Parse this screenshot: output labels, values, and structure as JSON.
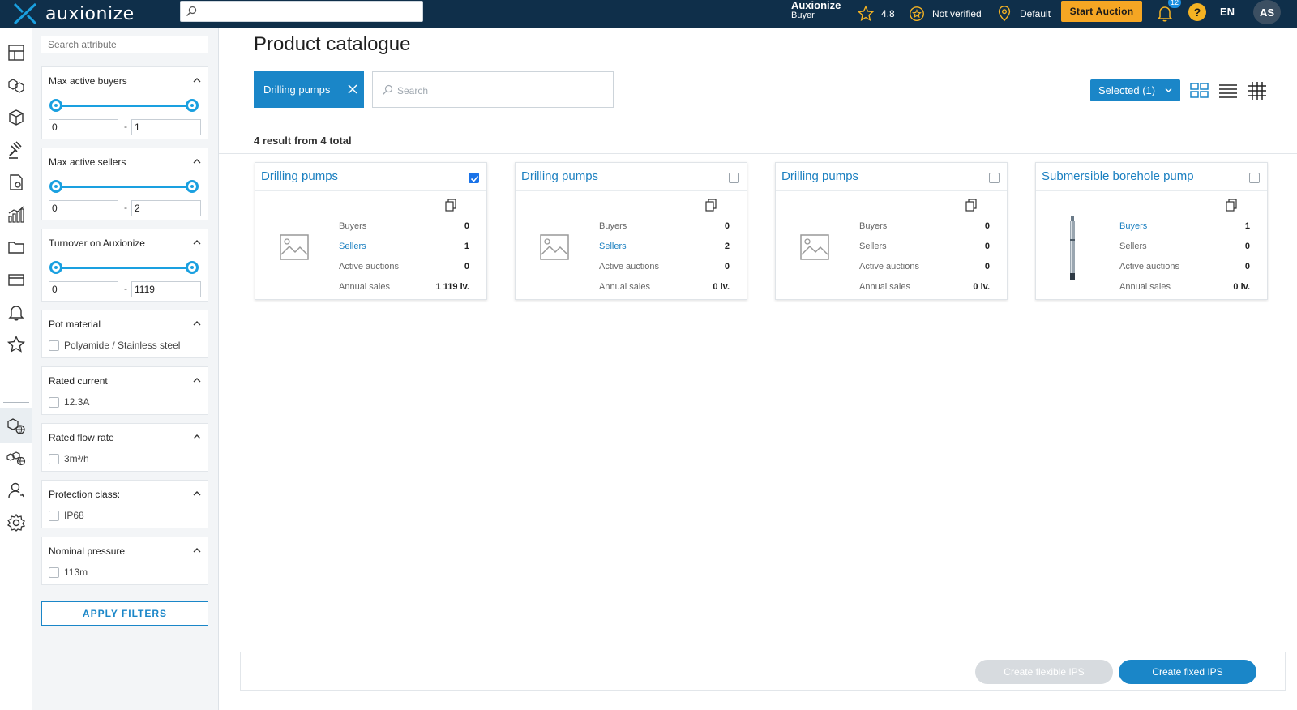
{
  "header": {
    "logo_text": "auxionize",
    "search_value": "",
    "user_name": "Auxionize",
    "user_role": "Buyer",
    "rating": "4.8",
    "verification": "Not verified",
    "location": "Default",
    "start_auction_label": "Start Auction",
    "notification_count": "12",
    "help_label": "?",
    "language": "EN",
    "avatar_initials": "AS",
    "colors": {
      "bar": "#0f2f4a",
      "accent": "#f5a623",
      "primary": "#1a86c8"
    }
  },
  "rail": {
    "icons": [
      "dashboard-icon",
      "products-icon",
      "box-icon",
      "auction-gavel-icon",
      "documents-icon",
      "analytics-icon",
      "folder-icon",
      "card-icon",
      "bell-icon",
      "star-icon",
      "product-catalogue-icon",
      "global-products-icon",
      "user-icon",
      "settings-icon"
    ],
    "expand_label": "»"
  },
  "filters": {
    "search_placeholder": "Search attribute",
    "ranges": [
      {
        "title": "Max active buyers",
        "min": "0",
        "max": "1",
        "separator": "-"
      },
      {
        "title": "Max active sellers",
        "min": "0",
        "max": "2",
        "separator": "-"
      },
      {
        "title": "Turnover on Auxionize",
        "min": "0",
        "max": "1119",
        "separator": "-"
      }
    ],
    "checks": [
      {
        "title": "Pot material",
        "option": "Polyamide / Stainless steel"
      },
      {
        "title": "Rated current",
        "option": "12.3A"
      },
      {
        "title": "Rated flow rate",
        "option": "3m³/h"
      },
      {
        "title": "Protection class:",
        "option": "IP68"
      },
      {
        "title": "Nominal pressure",
        "option": "113m"
      }
    ],
    "apply_label": "APPLY FILTERS"
  },
  "main": {
    "title": "Product catalogue",
    "chip_label": "Drilling pumps",
    "search_placeholder": "Search",
    "selected_label": "Selected (1)",
    "result_text": "4 result from 4 total",
    "stat_labels": [
      "Buyers",
      "Sellers",
      "Active auctions",
      "Annual sales"
    ],
    "cards": [
      {
        "title": "Drilling pumps",
        "checked": true,
        "buyers": "0",
        "sellers": "1",
        "active_auctions": "0",
        "annual_sales": "1 119 lv."
      },
      {
        "title": "Drilling pumps",
        "checked": false,
        "buyers": "0",
        "sellers": "2",
        "active_auctions": "0",
        "annual_sales": "0 lv."
      },
      {
        "title": "Drilling pumps",
        "checked": false,
        "buyers": "0",
        "sellers": "0",
        "active_auctions": "0",
        "annual_sales": "0 lv."
      },
      {
        "title": "Submersible borehole pump",
        "checked": false,
        "buyers": "1",
        "sellers": "0",
        "active_auctions": "0",
        "annual_sales": "0 lv."
      }
    ],
    "create_flexible_label": "Create flexible IPS",
    "create_fixed_label": "Create fixed IPS"
  }
}
